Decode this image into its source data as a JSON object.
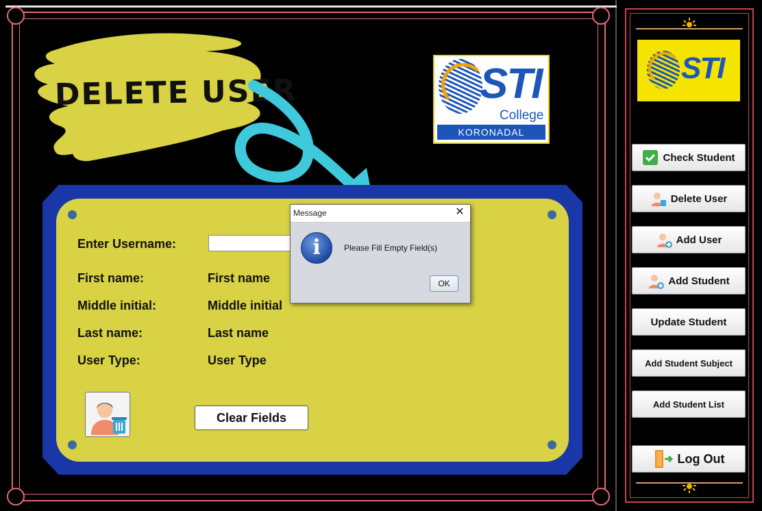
{
  "main": {
    "banner_title": "DELETE USER",
    "logo": {
      "brand": "STI",
      "sub": "College",
      "campus": "KORONADAL"
    },
    "form": {
      "username_label": "Enter Username:",
      "username_value": "",
      "fields": [
        {
          "label": "First name:",
          "value": "First name"
        },
        {
          "label": "Middle initial:",
          "value": "Middle initial"
        },
        {
          "label": "Last name:",
          "value": "Last name"
        },
        {
          "label": "User Type:",
          "value": "User Type"
        }
      ],
      "clear_label": "Clear Fields",
      "delete_icon": "user-trash-icon"
    }
  },
  "dialog": {
    "title": "Message",
    "message": "Please Fill Empty Field(s)",
    "ok_label": "OK",
    "icon": "info-icon"
  },
  "sidebar": {
    "logo_brand": "STI",
    "buttons": [
      {
        "label": "Check Student",
        "icon": "check-icon"
      },
      {
        "label": "Delete User",
        "icon": "user-trash-icon"
      },
      {
        "label": "Add User",
        "icon": "user-add-icon"
      },
      {
        "label": "Add Student",
        "icon": "user-add-icon"
      },
      {
        "label": "Update Student",
        "icon": ""
      },
      {
        "label": "Add Student Subject",
        "icon": ""
      },
      {
        "label": "Add Student List",
        "icon": ""
      },
      {
        "label": "Log Out",
        "icon": "exit-door-icon"
      }
    ]
  },
  "colors": {
    "panel_blue": "#1a37a8",
    "panel_yellow": "#d8d244",
    "frame_red": "#e36a72",
    "accent_cyan": "#3fc9dc",
    "logo_blue": "#1d56b8"
  }
}
